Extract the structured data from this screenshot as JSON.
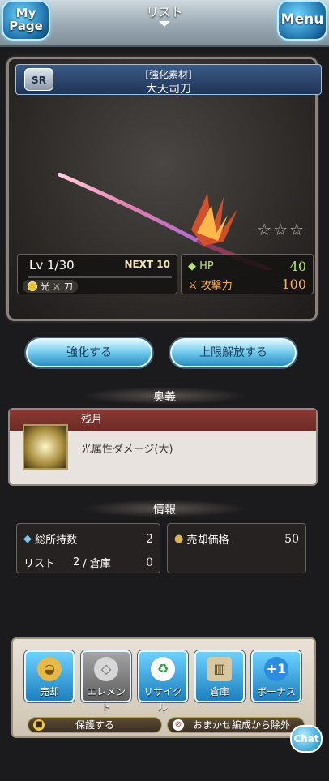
{
  "topbar": {
    "title": "リスト",
    "mypage_label": "My Page",
    "menu_label": "Menu"
  },
  "weapon": {
    "rarity": "SR",
    "category": "[強化素材]",
    "name": "大天司刀",
    "stars_filled": 0,
    "stars_total": 3,
    "level": "Lv 1/30",
    "next_exp": "NEXT 10",
    "element": "光",
    "weapon_type": "刀",
    "hp_label": "HP",
    "hp_value": "40",
    "atk_label": "攻撃力",
    "atk_value": "100"
  },
  "actions": {
    "upgrade": "強化する",
    "uncap": "上限解放する"
  },
  "ougi": {
    "section_title": "奥義",
    "name": "残月",
    "description": "光属性ダメージ(大)"
  },
  "info": {
    "section_title": "情報",
    "owned_label": "総所持数",
    "owned_value": "2",
    "list_label": "リスト",
    "list_value": "2",
    "storage_label": "/ 倉庫",
    "storage_value": "0",
    "sell_label": "売却価格",
    "sell_value": "50"
  },
  "tray": {
    "buttons": [
      {
        "label": "売却",
        "icon": "coin-icon"
      },
      {
        "label": "エレメント",
        "icon": "element-icon"
      },
      {
        "label": "リサイクル",
        "icon": "recycle-icon"
      },
      {
        "label": "倉庫",
        "icon": "storage-icon"
      },
      {
        "label": "ボーナス",
        "icon": "bonus-icon",
        "badge": "+1"
      }
    ],
    "protect_label": "保護する",
    "exclude_label": "おまかせ編成から除外"
  },
  "chat_label": "Chat",
  "colors": {
    "accent_blue": "#2a8dc0",
    "ougi_header": "#7a2f2a",
    "hp": "#b7ea63",
    "atk": "#ffb44d"
  }
}
